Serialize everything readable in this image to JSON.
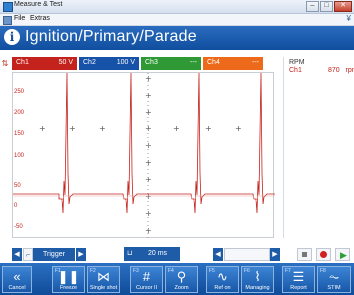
{
  "window": {
    "title": "Measure & Test"
  },
  "menu": {
    "items": [
      "File",
      "Extras"
    ]
  },
  "header": {
    "title": "Ignition/Primary/Parade"
  },
  "channels": [
    {
      "name": "Ch1",
      "value": "50 V",
      "color": "#c4221c"
    },
    {
      "name": "Ch2",
      "value": "100 V",
      "color": "#1552a8"
    },
    {
      "name": "Ch3",
      "value": "---",
      "color": "#2f9a35"
    },
    {
      "name": "Ch4",
      "value": "---",
      "color": "#ec6a1a"
    }
  ],
  "plot": {
    "y_ticks": [
      "250",
      "200",
      "150",
      "100",
      "50",
      "0",
      "-50"
    ]
  },
  "readout": {
    "label": "RPM",
    "channel": "Ch1",
    "value": "870",
    "unit": "rpm"
  },
  "controls": {
    "trigger_label": "Trigger",
    "timebase": "20 ms"
  },
  "fkeys": [
    {
      "key": "",
      "label": "Cancel",
      "icon": "cancel-icon"
    },
    {
      "key": "F1",
      "label": "Freeze",
      "icon": "pause-icon"
    },
    {
      "key": "F2",
      "label": "Single shot",
      "icon": "single-shot-icon"
    },
    {
      "key": "F3",
      "label": "Cursor II",
      "icon": "cursor-icon"
    },
    {
      "key": "F4",
      "label": "Zoom",
      "icon": "zoom-icon"
    },
    {
      "key": "F5",
      "label": "Ref on",
      "icon": "reference-icon"
    },
    {
      "key": "F6",
      "label": "Managing",
      "icon": "managing-icon"
    },
    {
      "key": "F7",
      "label": "Report",
      "icon": "report-icon"
    },
    {
      "key": "F8",
      "label": "STIM",
      "icon": "stim-icon"
    }
  ]
}
